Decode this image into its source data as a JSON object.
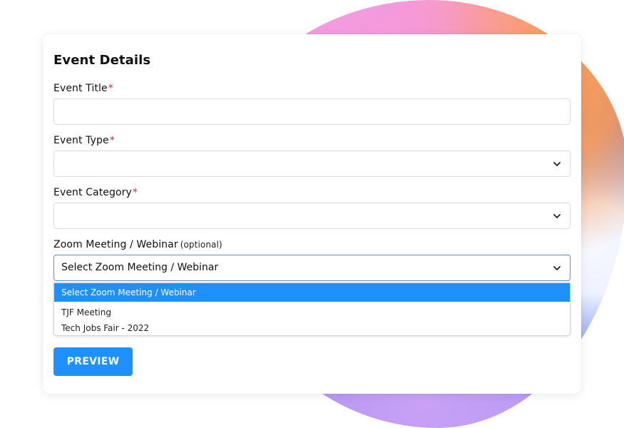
{
  "form": {
    "title": "Event Details",
    "fields": {
      "event_title": {
        "label": "Event Title",
        "required_mark": "*",
        "value": ""
      },
      "event_type": {
        "label": "Event Type",
        "required_mark": "*",
        "value": ""
      },
      "event_category": {
        "label": "Event Category",
        "required_mark": "*",
        "value": ""
      },
      "zoom_meeting": {
        "label": "Zoom Meeting / Webinar",
        "optional_note": "(optional)",
        "value": "Select Zoom Meeting / Webinar",
        "options": [
          "Select Zoom Meeting / Webinar",
          "TJF Meeting",
          "Tech Jobs Fair - 2022"
        ],
        "highlighted_option": "Select Zoom Meeting / Webinar"
      }
    },
    "buttons": {
      "preview": "PREVIEW"
    }
  },
  "icons": {
    "dropdown_arrow": "chevron-down-icon"
  },
  "colors": {
    "accent_blue": "#1e90ff",
    "required_red": "#e02424",
    "active_border": "#5a91c8",
    "border_gray": "#dcdcdc"
  }
}
